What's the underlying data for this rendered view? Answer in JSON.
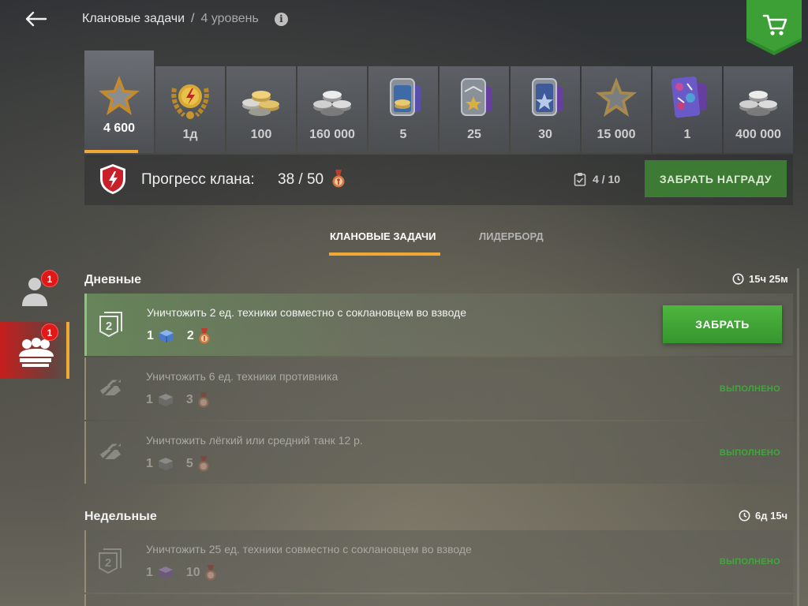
{
  "header": {
    "title": "Клановые задачи",
    "separator": "/",
    "level": "4 уровень",
    "info_glyph": "i",
    "back_icon": "arrow-left-icon",
    "shop_icon": "cart-icon"
  },
  "rewards": [
    {
      "label": "4 600",
      "icon": "gold-star-icon",
      "active": true
    },
    {
      "label": "1д",
      "icon": "laurel-emblem-icon"
    },
    {
      "label": "100",
      "icon": "gold-coins-icon"
    },
    {
      "label": "160 000",
      "icon": "silver-coins-icon"
    },
    {
      "label": "5",
      "icon": "dogtag-coins-icon"
    },
    {
      "label": "25",
      "icon": "dogtag-star-icon"
    },
    {
      "label": "30",
      "icon": "dogtag-blue-star-icon"
    },
    {
      "label": "15 000",
      "icon": "star-icon"
    },
    {
      "label": "1",
      "icon": "camo-card-icon"
    },
    {
      "label": "400 000",
      "icon": "silver-coins-icon"
    }
  ],
  "progress": {
    "label": "Прогресс клана:",
    "current": "38",
    "separator": "/",
    "total": "50",
    "tasks_done": "4 / 10",
    "claim_label": "ЗАБРАТЬ НАГРАДУ"
  },
  "tabs": [
    {
      "label": "КЛАНОВЫЕ ЗАДАЧИ",
      "active": true
    },
    {
      "label": "ЛИДЕРБОРД",
      "active": false
    }
  ],
  "sidebar": {
    "profile_badge": "1",
    "clan_badge": "1"
  },
  "daily": {
    "title": "Дневные",
    "timer": "15ч 25м",
    "tasks": [
      {
        "text": "Уничтожить 2 ед. техники совместно с соклановцем во взводе",
        "reward_1": "1",
        "reward_2": "2",
        "status": "ready",
        "action_label": "ЗАБРАТЬ",
        "icon": "platoon-2-icon"
      },
      {
        "text": "Уничтожить 6 ед. техники противника",
        "reward_1": "1",
        "reward_2": "3",
        "status": "done",
        "status_label": "ВЫПОЛНЕНО",
        "icon": "destroyed-tank-icon"
      },
      {
        "text": "Уничтожить лёгкий или средний танк 12 р.",
        "reward_1": "1",
        "reward_2": "5",
        "status": "done",
        "status_label": "ВЫПОЛНЕНО",
        "icon": "destroyed-tank-icon"
      }
    ]
  },
  "weekly": {
    "title": "Недельные",
    "timer": "6д 15ч",
    "tasks": [
      {
        "text": "Уничтожить 25 ед. техники совместно с соклановцем во взводе",
        "reward_1": "1",
        "reward_2": "10",
        "status": "done",
        "status_label": "ВЫПОЛНЕНО",
        "icon": "platoon-2-icon"
      }
    ]
  },
  "colors": {
    "accent": "#f0a733",
    "claim_green": "#3ea83a",
    "badge_red": "#e01818"
  }
}
